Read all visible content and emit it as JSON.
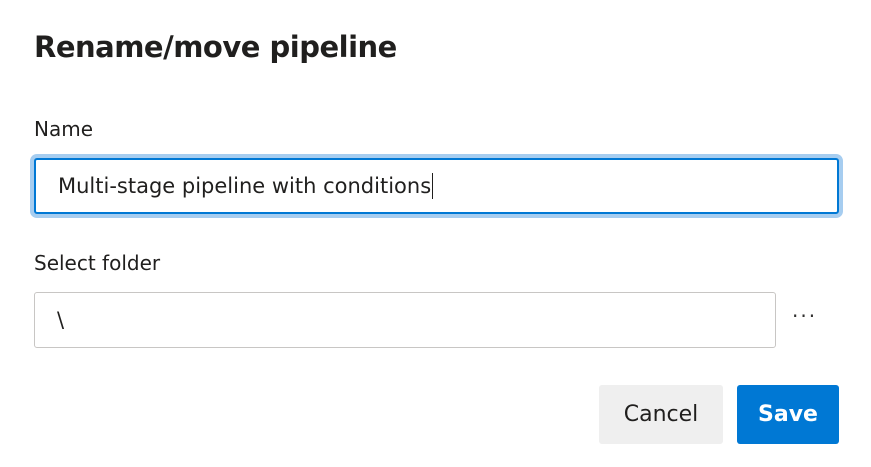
{
  "dialog": {
    "title": "Rename/move pipeline",
    "name_label": "Name",
    "name_value": "Multi-stage pipeline with conditions",
    "folder_label": "Select folder",
    "folder_value": "\\",
    "more_label": "···",
    "cancel_label": "Cancel",
    "save_label": "Save"
  },
  "colors": {
    "accent": "#0078d4",
    "focus_ring": "#a6cdf0",
    "cancel_bg": "#efefef"
  }
}
